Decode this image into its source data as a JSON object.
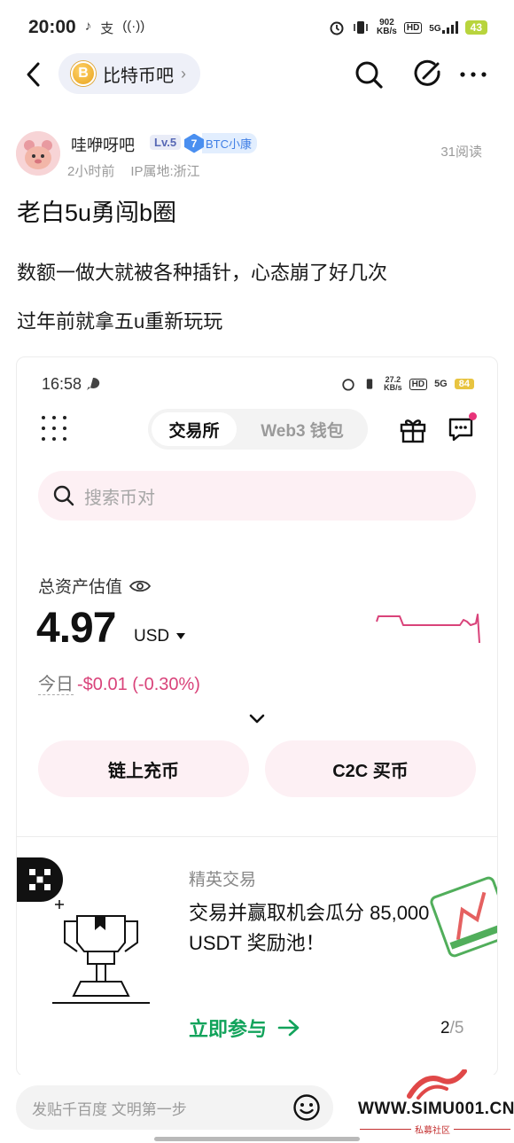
{
  "status_bar": {
    "time": "20:00",
    "left_icons": [
      "♪",
      "支",
      "((·))"
    ],
    "net_speed_top": "902",
    "net_speed_bottom": "KB/s",
    "hd": "HD",
    "signal": "5G",
    "battery": "43"
  },
  "nav": {
    "forum_name": "比特币吧",
    "forum_coin": "B"
  },
  "post": {
    "author": "哇咿呀吧",
    "level": "Lv.5",
    "badge_num": "7",
    "badge_text": "BTC小康",
    "time_ago": "2小时前",
    "ip_location": "IP属地:浙江",
    "reads": "31阅读",
    "title": "老白5u勇闯b圈",
    "lines": [
      "数额一做大就被各种插针，心态崩了好几次",
      "过年前就拿五u重新玩玩"
    ]
  },
  "embed": {
    "status_time": "16:58",
    "status_speed_top": "27.2",
    "status_speed_bottom": "KB/s",
    "status_hd": "HD",
    "status_signal": "5G",
    "status_battery": "84",
    "tab_exchange": "交易所",
    "tab_web3": "Web3 钱包",
    "search_placeholder": "搜索币对",
    "asset_label": "总资产估值",
    "amount": "4.97",
    "currency": "USD",
    "today_label": "今日",
    "today_change": "-$0.01 (-0.30%)",
    "btn_onchain": "链上充币",
    "btn_c2c": "C2C 买币",
    "promo_title": "精英交易",
    "promo_body": "交易并赢取机会瓜分 85,000 USDT 奖励池！",
    "promo_cta": "立即参与",
    "page_current": "2",
    "page_total": "/5",
    "accent_green": "#12a35b",
    "accent_pink": "#d9437a"
  },
  "reply": {
    "placeholder": "发贴千百度 文明第一步"
  },
  "site_watermark": {
    "url": "WWW.SIMU001.CN",
    "name": "私募社区"
  }
}
